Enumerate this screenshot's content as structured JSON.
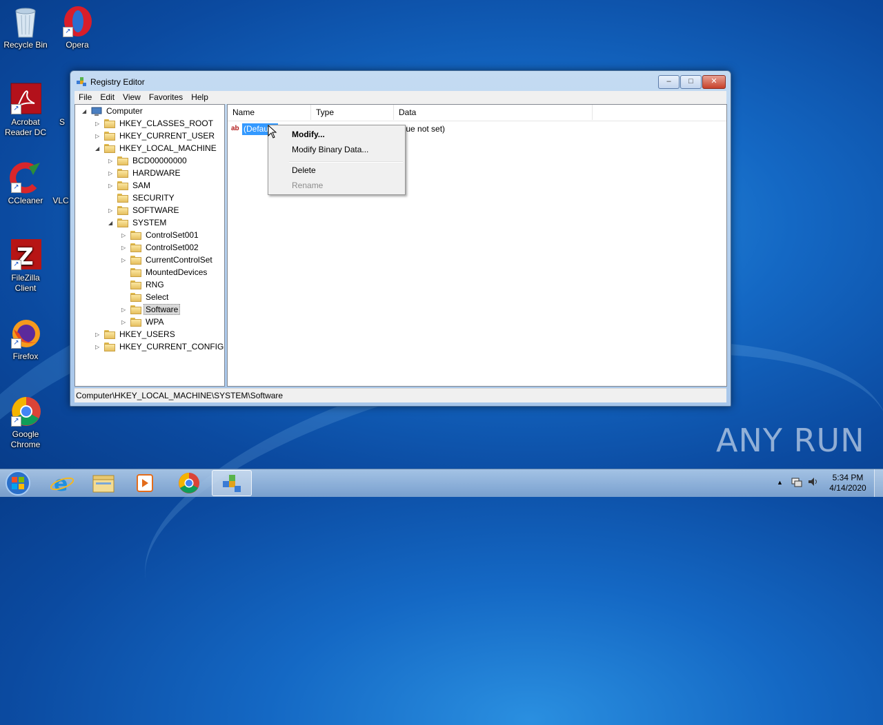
{
  "desktop": {
    "icons": [
      {
        "label": "Recycle Bin"
      },
      {
        "label": "Opera"
      },
      {
        "label": "Acrobat Reader DC"
      },
      {
        "label": "CCleaner"
      },
      {
        "label": "FileZilla Client"
      },
      {
        "label": "Firefox"
      },
      {
        "label": "Google Chrome"
      },
      {
        "label": "S"
      },
      {
        "label": "VLC"
      }
    ]
  },
  "window": {
    "title": "Registry Editor",
    "minimize_label": "–",
    "maximize_label": "□",
    "close_label": "✕",
    "menu": [
      "File",
      "Edit",
      "View",
      "Favorites",
      "Help"
    ],
    "tree": [
      {
        "label": "Computer",
        "expander": "◢"
      },
      {
        "label": "HKEY_CLASSES_ROOT",
        "expander": "▷"
      },
      {
        "label": "HKEY_CURRENT_USER",
        "expander": "▷"
      },
      {
        "label": "HKEY_LOCAL_MACHINE",
        "expander": "◢"
      },
      {
        "label": "BCD00000000",
        "expander": "▷"
      },
      {
        "label": "HARDWARE",
        "expander": "▷"
      },
      {
        "label": "SAM",
        "expander": "▷"
      },
      {
        "label": "SECURITY",
        "expander": ""
      },
      {
        "label": "SOFTWARE",
        "expander": "▷"
      },
      {
        "label": "SYSTEM",
        "expander": "◢"
      },
      {
        "label": "ControlSet001",
        "expander": "▷"
      },
      {
        "label": "ControlSet002",
        "expander": "▷"
      },
      {
        "label": "CurrentControlSet",
        "expander": "▷"
      },
      {
        "label": "MountedDevices",
        "expander": ""
      },
      {
        "label": "RNG",
        "expander": ""
      },
      {
        "label": "Select",
        "expander": ""
      },
      {
        "label": "Software",
        "expander": "▷"
      },
      {
        "label": "WPA",
        "expander": "▷"
      },
      {
        "label": "HKEY_USERS",
        "expander": "▷"
      },
      {
        "label": "HKEY_CURRENT_CONFIG",
        "expander": "▷"
      }
    ],
    "columns": [
      "Name",
      "Type",
      "Data"
    ],
    "values": [
      {
        "name": "(Defau",
        "data": "alue not set)",
        "icon": "ab"
      }
    ],
    "status_path": "Computer\\HKEY_LOCAL_MACHINE\\SYSTEM\\Software"
  },
  "context_menu": {
    "items": [
      "Modify...",
      "Modify Binary Data...",
      "Delete",
      "Rename"
    ]
  },
  "taskbar": {
    "clock_time": "5:34 PM",
    "clock_date": "4/14/2020",
    "tray_arrow": "▲"
  },
  "watermark": "ANY  RUN",
  "colors": {
    "selection": "#3399ff",
    "desktop": "#1468c4"
  }
}
